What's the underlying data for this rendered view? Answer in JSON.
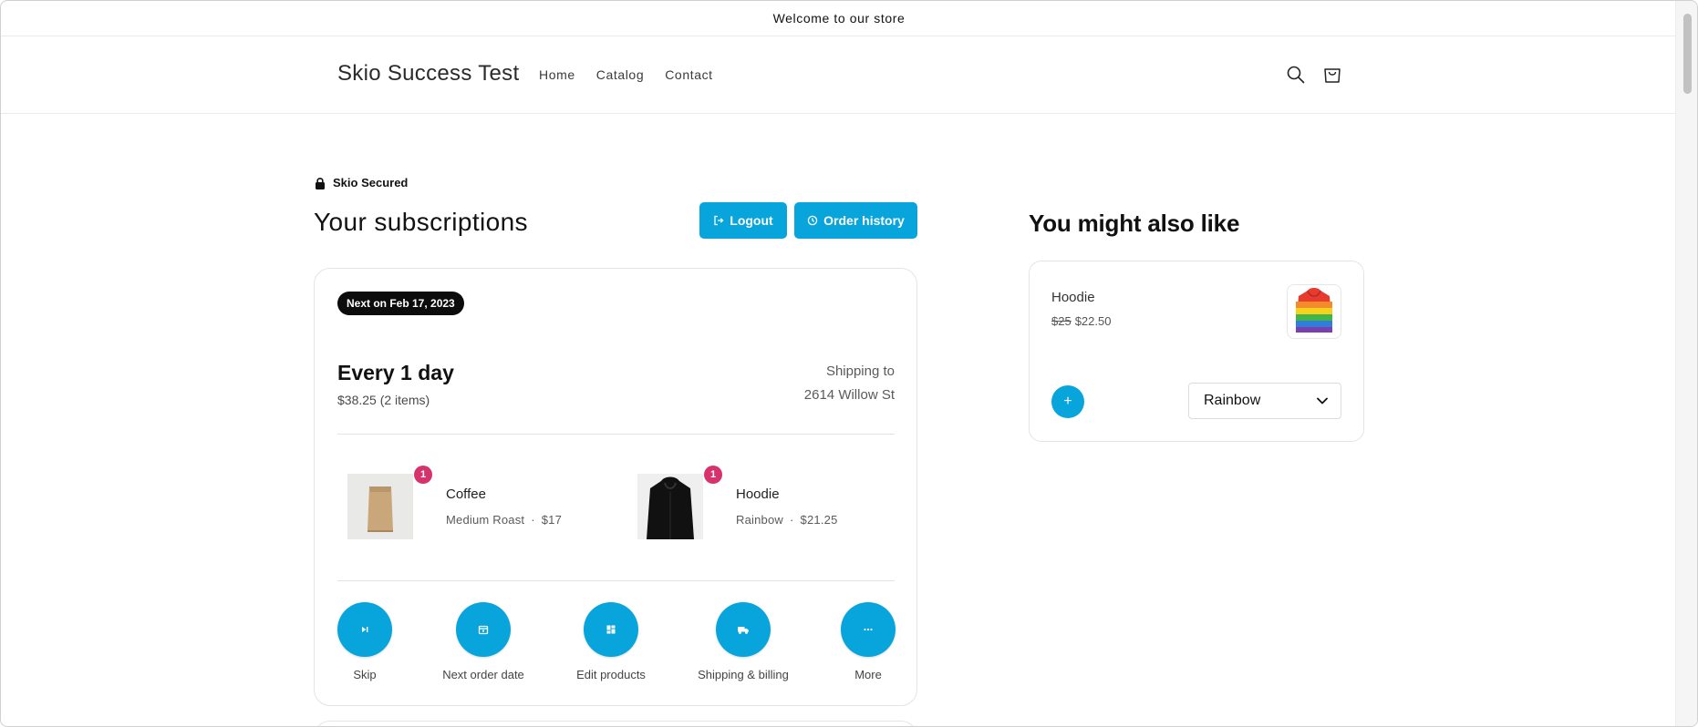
{
  "announcement": "Welcome to our store",
  "header": {
    "brand": "Skio Success Test",
    "nav": [
      "Home",
      "Catalog",
      "Contact"
    ],
    "search_icon": "search-icon",
    "cart_icon": "cart-icon"
  },
  "portal": {
    "secured_label": "Skio Secured",
    "title": "Your subscriptions",
    "logout_label": "Logout",
    "history_label": "Order history"
  },
  "subscription": {
    "next_badge": "Next on Feb 17, 2023",
    "frequency": "Every 1 day",
    "summary": "$38.25 (2 items)",
    "shipping_label": "Shipping to",
    "shipping_address": "2614 Willow St",
    "items": [
      {
        "qty": "1",
        "name": "Coffee",
        "variant": "Medium Roast",
        "price": "$17"
      },
      {
        "qty": "1",
        "name": "Hoodie",
        "variant": "Rainbow",
        "price": "$21.25"
      }
    ],
    "actions": [
      "Skip",
      "Next order date",
      "Edit products",
      "Shipping & billing",
      "More"
    ]
  },
  "recommendations": {
    "title": "You might also like",
    "product": {
      "name": "Hoodie",
      "old_price": "$25",
      "price": "$22.50",
      "variant_selected": "Rainbow",
      "add_label": "+"
    }
  },
  "colors": {
    "accent": "#08a4dc",
    "badge": "#d6336c",
    "next_badge_bg": "#0c0c0c"
  }
}
